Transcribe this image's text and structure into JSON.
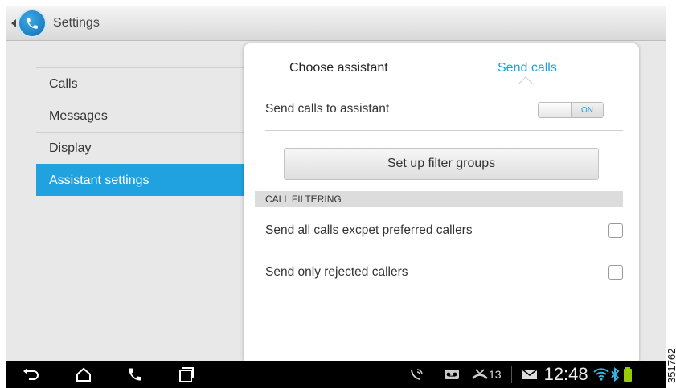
{
  "app": {
    "title": "Settings"
  },
  "left_menu": {
    "items": [
      {
        "label": "Calls",
        "selected": false
      },
      {
        "label": "Messages",
        "selected": false
      },
      {
        "label": "Display",
        "selected": false
      },
      {
        "label": "Assistant settings",
        "selected": true
      }
    ]
  },
  "panel": {
    "tabs": [
      {
        "label": "Choose assistant",
        "active": false
      },
      {
        "label": "Send calls",
        "active": true
      }
    ],
    "send_calls_label": "Send calls to assistant",
    "toggle_state": "ON",
    "filter_button_label": "Set up filter groups",
    "section_header": "CALL FILTERING",
    "options": [
      {
        "label": "Send all calls excpet preferred callers",
        "checked": false
      },
      {
        "label": "Send only rejected callers",
        "checked": false
      }
    ]
  },
  "status_bar": {
    "missed_count": "13",
    "time": "12:48"
  },
  "colors": {
    "accent": "#20a2e0"
  },
  "watermark": "351762"
}
